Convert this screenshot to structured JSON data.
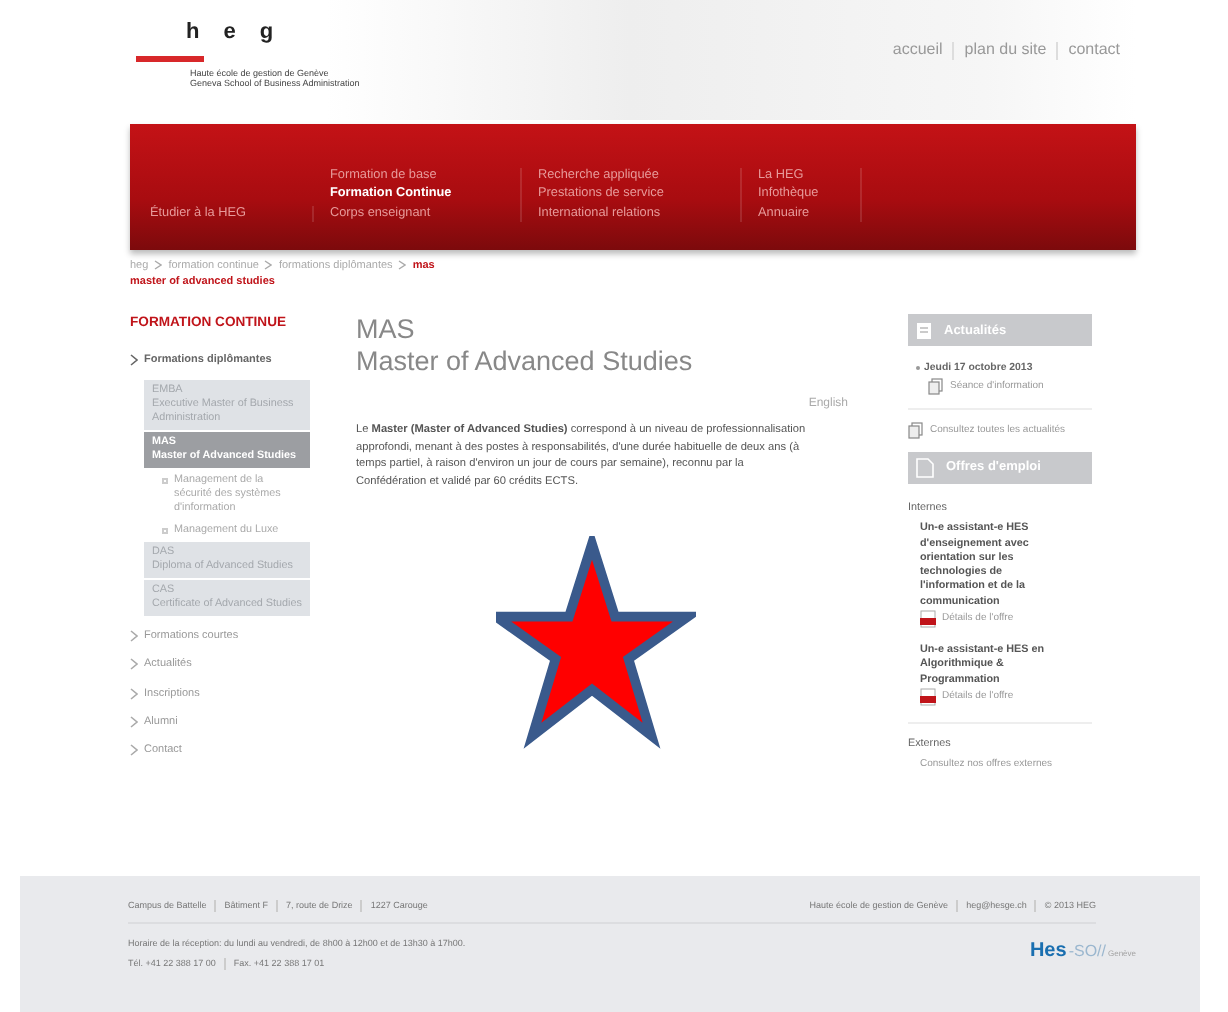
{
  "header": {
    "logo_letters": [
      "h",
      "e",
      "g"
    ],
    "tagline": [
      "Haute école de gestion de Genève",
      "Geneva School of Business Administration"
    ],
    "top_links": [
      "accueil",
      "plan du site",
      "contact"
    ]
  },
  "nav": {
    "columns": [
      {
        "items": [
          {
            "label": "Étudier à la HEG",
            "selected": false
          }
        ]
      },
      {
        "items": [
          {
            "label": "Formation de base",
            "selected": false
          },
          {
            "label": "Formation Continue",
            "selected": true
          },
          {
            "label": "Corps enseignant",
            "selected": false
          }
        ]
      },
      {
        "items": [
          {
            "label": "Recherche appliquée",
            "selected": false
          },
          {
            "label": "Prestations de service",
            "selected": false
          },
          {
            "label": "International relations",
            "selected": false
          }
        ]
      },
      {
        "items": [
          {
            "label": "La HEG",
            "selected": false
          },
          {
            "label": "Infothèque",
            "selected": false
          },
          {
            "label": "Annuaire",
            "selected": false
          }
        ]
      }
    ]
  },
  "breadcrumb": {
    "items": [
      "heg",
      "formation continue",
      "formations diplômantes"
    ],
    "current": "mas",
    "current_subtitle": "master of advanced studies"
  },
  "sidebar": {
    "heading": "FORMATION CONTINUE",
    "items": [
      {
        "label": "Formations diplômantes",
        "expanded": true,
        "children": [
          {
            "kind": "box",
            "title": "EMBA",
            "subtitle": "Executive Master of Business Administration",
            "selected": false
          },
          {
            "kind": "box",
            "title": "MAS",
            "subtitle": "Master of Advanced Studies",
            "selected": true
          },
          {
            "kind": "link",
            "title": "Management de la sécurité des systèmes d'information"
          },
          {
            "kind": "link",
            "title": "Management du Luxe"
          },
          {
            "kind": "box",
            "title": "DAS",
            "subtitle": "Diploma of Advanced Studies",
            "selected": false
          },
          {
            "kind": "box",
            "title": "CAS",
            "subtitle": "Certificate of Advanced Studies",
            "selected": false
          }
        ]
      },
      {
        "label": "Formations courtes",
        "expanded": false
      },
      {
        "label": "Actualités",
        "expanded": false
      },
      {
        "label": "Inscriptions",
        "expanded": false
      },
      {
        "label": "Alumni",
        "expanded": false
      },
      {
        "label": "Contact",
        "expanded": false
      }
    ]
  },
  "main": {
    "title": "MAS",
    "subtitle": "Master of Advanced Studies",
    "language_link": "English",
    "body": "Le **Master (Master of Advanced Studies)** correspond à un niveau de professionnalisation approfondi, menant à des postes à responsabilités, d'une durée habituelle de deux ans (à temps partiel, à raison d'environ un jour de cours par semaine), reconnu par la Confédération et validé par 60 crédits ECTS."
  },
  "overlay": {
    "kind": "star"
  },
  "news": {
    "title": "Actualités",
    "items": [
      {
        "date": "Jeudi 17 octobre 2013",
        "link": "Séance d'information"
      }
    ],
    "all_link": "Consultez toutes les actualités"
  },
  "jobs": {
    "title": "Offres d'emploi",
    "internal_heading": "Internes",
    "internal": [
      {
        "title": "Un-e assistant-e HES d'enseignement avec orientation sur les technologies de l'information et de la communication",
        "link": "Détails de l'offre"
      },
      {
        "title": "Un-e assistant-e HES en Algorithmique & Programmation",
        "link": "Détails de l'offre"
      }
    ],
    "external_heading": "Externes",
    "external": [
      "Consultez nos offres externes"
    ]
  },
  "footer": {
    "address": [
      "Campus de Battelle",
      "Bâtiment F",
      "7, route de Drize",
      "1227 Carouge"
    ],
    "right": [
      "Haute école de gestion de Genève",
      "heg@hesge.ch",
      "© 2013 HEG"
    ],
    "hours": "Horaire de la réception: du lundi au vendredi, de 8h00 à 12h00 et de 13h30 à 17h00.",
    "phones": [
      "Tél. +41 22 388 17 00",
      "Fax. +41 22 388 17 01"
    ],
    "logo": {
      "main": "Hes",
      "rest": "-SO//",
      "city": "Genève"
    }
  }
}
